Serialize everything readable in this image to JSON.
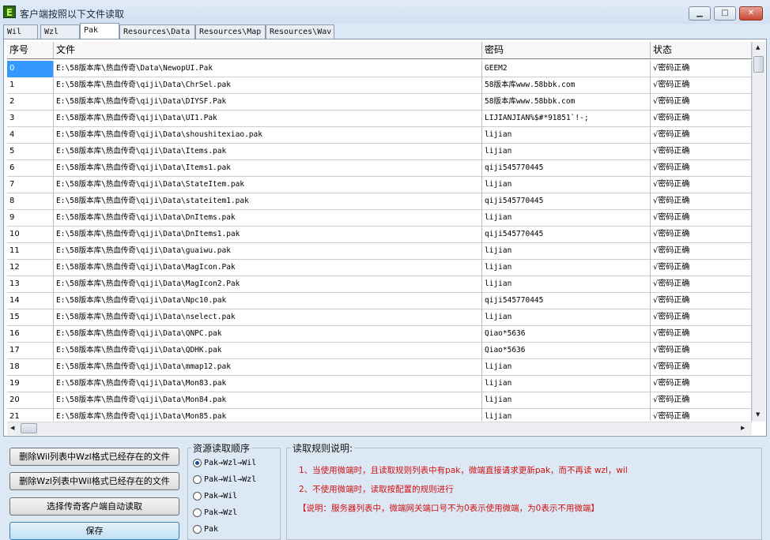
{
  "window": {
    "title": "客户端按照以下文件读取",
    "app_icon": "E"
  },
  "tabs": [
    "Wil",
    "Wzl",
    "Pak",
    "Resources\\Data",
    "Resources\\Map",
    "Resources\\Wav"
  ],
  "active_tab": 2,
  "table": {
    "headers": [
      "序号",
      "文件",
      "密码",
      "状态"
    ],
    "rows": [
      [
        "0",
        "E:\\58版本库\\热血传奇\\Data\\NewopUI.Pak",
        "GEEM2",
        "√密码正确"
      ],
      [
        "1",
        "E:\\58版本库\\热血传奇\\qiji\\Data\\ChrSel.pak",
        "58版本库www.58bbk.com",
        "√密码正确"
      ],
      [
        "2",
        "E:\\58版本库\\热血传奇\\qiji\\Data\\DIYSF.Pak",
        "58版本库www.58bbk.com",
        "√密码正确"
      ],
      [
        "3",
        "E:\\58版本库\\热血传奇\\qiji\\Data\\UI1.Pak",
        "LIJIANJIAN%$#*91851`!-;",
        "√密码正确"
      ],
      [
        "4",
        "E:\\58版本库\\热血传奇\\qiji\\Data\\shoushitexiao.pak",
        "lijian",
        "√密码正确"
      ],
      [
        "5",
        "E:\\58版本库\\热血传奇\\qiji\\Data\\Items.pak",
        "lijian",
        "√密码正确"
      ],
      [
        "6",
        "E:\\58版本库\\热血传奇\\qiji\\Data\\Items1.pak",
        "qiji545770445",
        "√密码正确"
      ],
      [
        "7",
        "E:\\58版本库\\热血传奇\\qiji\\Data\\StateItem.pak",
        "lijian",
        "√密码正确"
      ],
      [
        "8",
        "E:\\58版本库\\热血传奇\\qiji\\Data\\stateitem1.pak",
        "qiji545770445",
        "√密码正确"
      ],
      [
        "9",
        "E:\\58版本库\\热血传奇\\qiji\\Data\\DnItems.pak",
        "lijian",
        "√密码正确"
      ],
      [
        "10",
        "E:\\58版本库\\热血传奇\\qiji\\Data\\DnItems1.pak",
        "qiji545770445",
        "√密码正确"
      ],
      [
        "11",
        "E:\\58版本库\\热血传奇\\qiji\\Data\\guaiwu.pak",
        "lijian",
        "√密码正确"
      ],
      [
        "12",
        "E:\\58版本库\\热血传奇\\qiji\\Data\\MagIcon.Pak",
        "lijian",
        "√密码正确"
      ],
      [
        "13",
        "E:\\58版本库\\热血传奇\\qiji\\Data\\MagIcon2.Pak",
        "lijian",
        "√密码正确"
      ],
      [
        "14",
        "E:\\58版本库\\热血传奇\\qiji\\Data\\Npc10.pak",
        "qiji545770445",
        "√密码正确"
      ],
      [
        "15",
        "E:\\58版本库\\热血传奇\\qiji\\Data\\nselect.pak",
        "lijian",
        "√密码正确"
      ],
      [
        "16",
        "E:\\58版本库\\热血传奇\\qiji\\Data\\QNPC.pak",
        "Qiao*5636",
        "√密码正确"
      ],
      [
        "17",
        "E:\\58版本库\\热血传奇\\qiji\\Data\\QDHK.pak",
        "Qiao*5636",
        "√密码正确"
      ],
      [
        "18",
        "E:\\58版本库\\热血传奇\\qiji\\Data\\mmap12.pak",
        "lijian",
        "√密码正确"
      ],
      [
        "19",
        "E:\\58版本库\\热血传奇\\qiji\\Data\\Mon83.pak",
        "lijian",
        "√密码正确"
      ],
      [
        "20",
        "E:\\58版本库\\热血传奇\\qiji\\Data\\Mon84.pak",
        "lijian",
        "√密码正确"
      ],
      [
        "21",
        "E:\\58版本库\\热血传奇\\qiji\\Data\\Mon85.pak",
        "lijian",
        "√密码正确"
      ]
    ]
  },
  "buttons": {
    "delete_wil": "删除Wil列表中Wzl格式已经存在的文件",
    "delete_wzl": "删除Wzl列表中Wil格式已经存在的文件",
    "auto_read": "选择传奇客户端自动读取",
    "save": "保存"
  },
  "resource_order": {
    "title": "资源读取顺序",
    "options": [
      "Pak→Wzl→Wil",
      "Pak→Wil→Wzl",
      "Pak→Wil",
      "Pak→Wzl",
      "Pak"
    ],
    "selected": 0
  },
  "rules": {
    "title": "读取规则说明:",
    "lines": [
      "1、当使用微端时，且读取规则列表中有pak，微端直接请求更新pak，而不再读 wzl，wil",
      "2、不使用微端时，读取按配置的规则进行",
      "【说明：服务器列表中，微端网关端口号不为0表示使用微端，为0表示不用微端】"
    ]
  },
  "colors": {
    "selection": "#3399ff",
    "rule_text": "#d01010"
  }
}
